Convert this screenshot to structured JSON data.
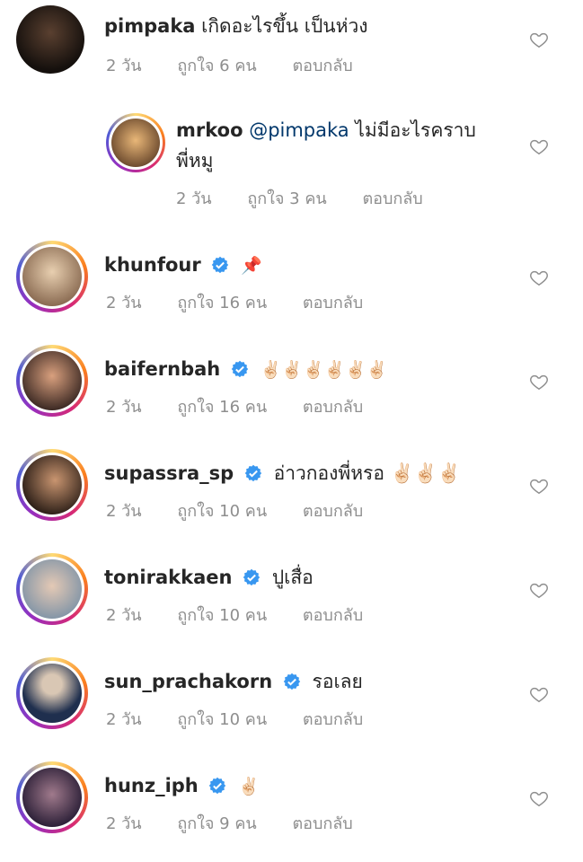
{
  "comments": [
    {
      "username": "pimpaka",
      "verified": false,
      "text": "เกิดอะไรขึ้น เป็นห่วง",
      "time": "2 วัน",
      "likes": "ถูกใจ 6 คน",
      "reply": "ตอบกลับ",
      "avatar_colors": [
        "#3a2a22",
        "#15100d"
      ]
    },
    {
      "username": "mrkoo",
      "mention": "@pimpaka",
      "text": "ไม่มีอะไรคราบ",
      "text2": "พี่หมู",
      "time": "2 วัน",
      "likes": "ถูกใจ 3 คน",
      "reply": "ตอบกลับ",
      "avatar_colors": [
        "#e9b778",
        "#6c4a2e"
      ]
    },
    {
      "username": "khunfour",
      "verified": true,
      "text": "📌",
      "time": "2 วัน",
      "likes": "ถูกใจ 16 คน",
      "reply": "ตอบกลับ",
      "avatar_colors": [
        "#d4b28a",
        "#8a6b52"
      ]
    },
    {
      "username": "baifernbah",
      "verified": true,
      "text": "✌🏻✌🏻✌🏻✌🏻✌🏻✌🏻",
      "time": "2 วัน",
      "likes": "ถูกใจ 16 คน",
      "reply": "ตอบกลับ",
      "avatar_colors": [
        "#c48d6d",
        "#3d2a24"
      ]
    },
    {
      "username": "supassra_sp",
      "verified": true,
      "text": "อ่าวกองพี่หรอ ✌🏻✌🏻✌🏻",
      "time": "2 วัน",
      "likes": "ถูกใจ 10 คน",
      "reply": "ตอบกลับ",
      "avatar_colors": [
        "#b8835c",
        "#2a1d16"
      ]
    },
    {
      "username": "tonirakkaen",
      "verified": true,
      "text": "ปูเสื่อ",
      "time": "2 วัน",
      "likes": "ถูกใจ 10 คน",
      "reply": "ตอบกลับ",
      "avatar_colors": [
        "#9eb2c4",
        "#e4c9b5"
      ]
    },
    {
      "username": "sun_prachakorn",
      "verified": true,
      "text": "รอเลย",
      "time": "2 วัน",
      "likes": "ถูกใจ 10 คน",
      "reply": "ตอบกลับ",
      "avatar_colors": [
        "#1f2f4e",
        "#d9c7b4"
      ]
    },
    {
      "username": "hunz_iph",
      "verified": true,
      "text": "✌🏻",
      "time": "2 วัน",
      "likes": "ถูกใจ 9 คน",
      "reply": "ตอบกลับ",
      "avatar_colors": [
        "#6b4b8c",
        "#2a1e36"
      ]
    }
  ],
  "colors": {
    "verified": "#3897f0",
    "meta": "#8e8e8e",
    "mention": "#00376b"
  }
}
